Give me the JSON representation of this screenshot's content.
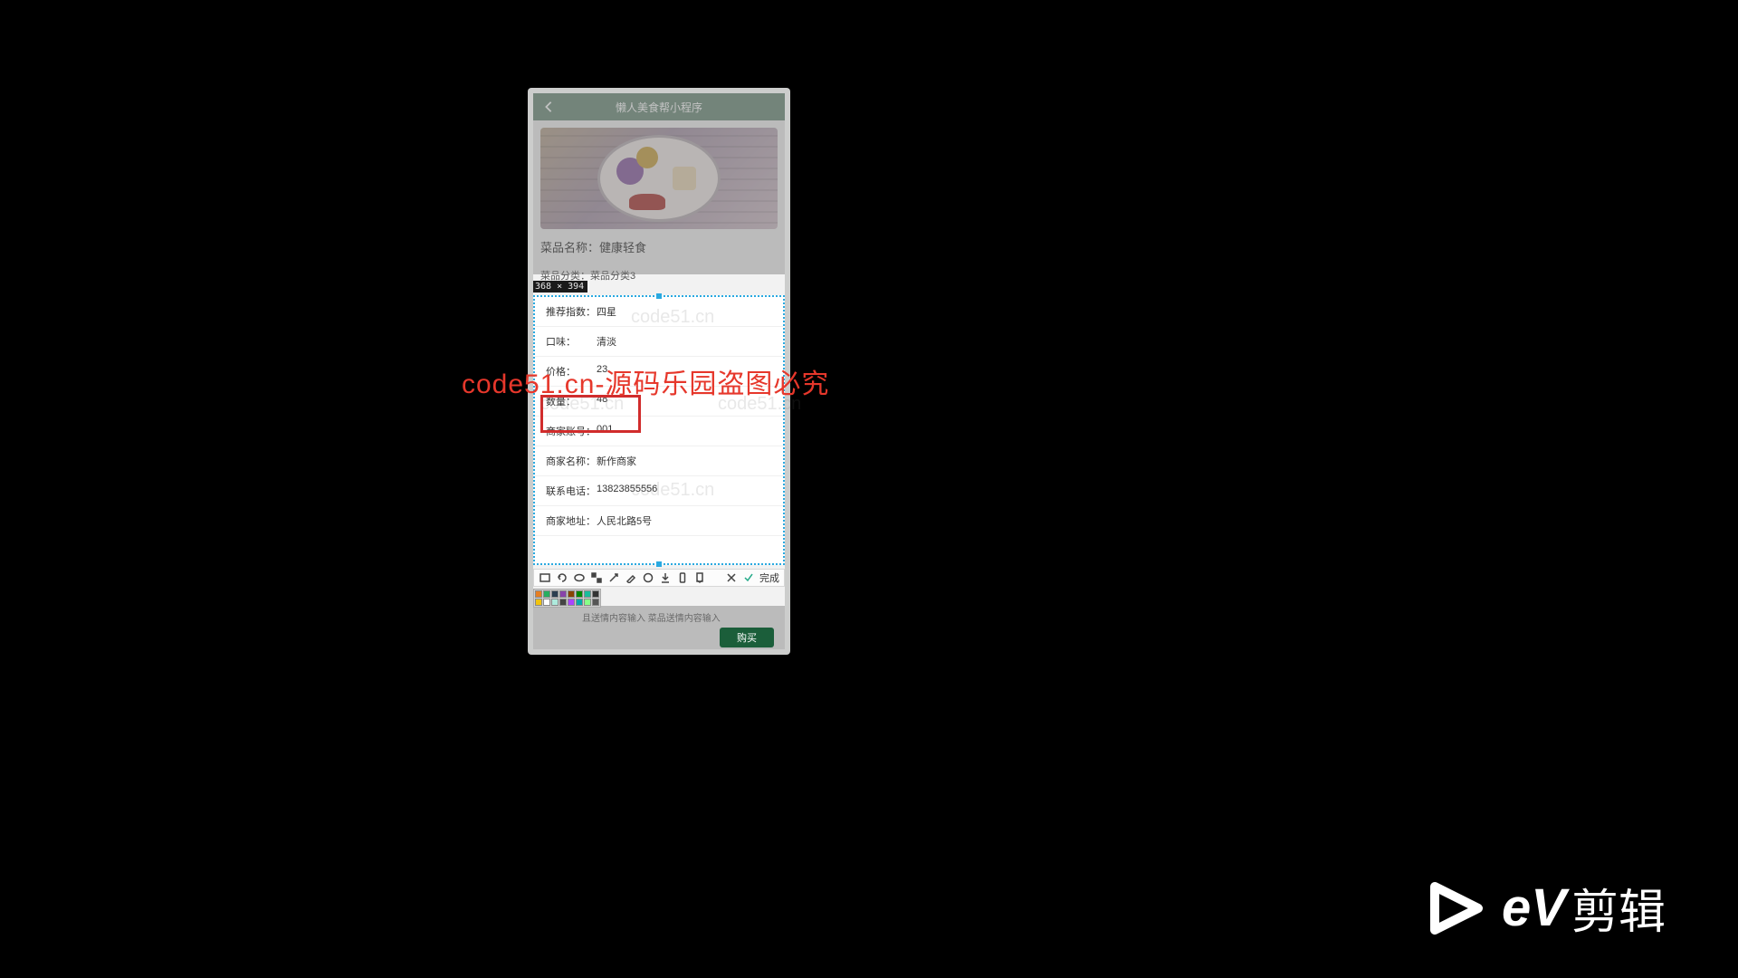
{
  "header": {
    "title": "懒人美食帮小程序"
  },
  "dish": {
    "name_label": "菜品名称：",
    "name": "健康轻食",
    "cat_label": "菜品分类：",
    "cat": "菜品分类3"
  },
  "selection_badge": "368 × 394",
  "details": [
    {
      "label": "推荐指数：",
      "value": "四星"
    },
    {
      "label": "口味：",
      "value": "清淡"
    },
    {
      "label": "价格：",
      "value": "23"
    },
    {
      "label": "数量：",
      "value": "48"
    },
    {
      "label": "商家账号：",
      "value": "001"
    },
    {
      "label": "商家名称：",
      "value": "新作商家"
    },
    {
      "label": "联系电话：",
      "value": "13823855556"
    },
    {
      "label": "商家地址：",
      "value": "人民北路5号"
    }
  ],
  "toolbar": {
    "done": "完成"
  },
  "hint": "且送情内容输入 菜品送情内容输入",
  "buy": "购买",
  "watermarks": {
    "small": "code51.cn",
    "red": "code51.cn-源码乐园盗图必究"
  },
  "ev": {
    "brand": "eV",
    "cn": "剪辑"
  },
  "palette": [
    "#e67e22",
    "#27ae60",
    "#2c3e50",
    "#8844aa",
    "#884400",
    "#008800",
    "#1abc9c",
    "#333333",
    "#f1c40f",
    "#ffffff",
    "#aeeadd",
    "#444444",
    "#aa44ff",
    "#00aaaa",
    "#88ff88",
    "#555555"
  ]
}
